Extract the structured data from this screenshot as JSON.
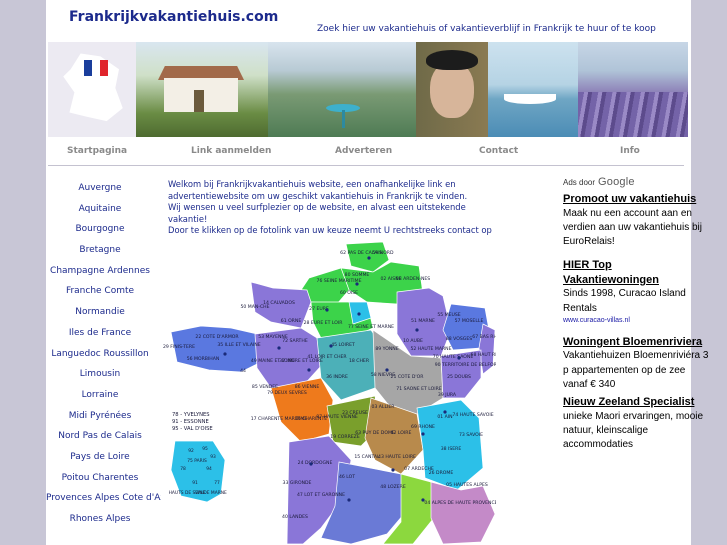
{
  "site": {
    "title": "Frankrijkvakantiehuis.com",
    "tagline": "Zoek hier uw vakantiehuis of vakantieverblijf in Frankrijk te huur of te koop"
  },
  "flag_colors": [
    "#1a3e9c",
    "#ffffff",
    "#e0242c"
  ],
  "nav": [
    {
      "label": "Startpagina"
    },
    {
      "label": "Link aanmelden"
    },
    {
      "label": "Adverteren"
    },
    {
      "label": "Contact"
    },
    {
      "label": "Info"
    }
  ],
  "regions": [
    "Auvergne",
    "Aquitaine",
    "Bourgogne",
    "Bretagne",
    "Champagne Ardennes",
    "Franche Comte",
    "Normandie",
    "Iles de France",
    "Languedoc Roussillon",
    "Limousin",
    "Lorraine",
    "Midi Pyrénées",
    "Nord Pas de Calais",
    "Pays de Loire",
    "Poitou Charentes",
    "Provences Alpes Cote d'Azur",
    "Rhones Alpes"
  ],
  "intro": {
    "line1": "Welkom bij Frankrijkvakantiehuis website, een onafhankelijke link en advertentiewebsite om uw geschikt vakantiehuis in Frankrijk te vinden.",
    "line2": "Wij wensen u veel surfplezier op de website, en alvast een uitstekende vakantie!",
    "line3": "Door te klikken op de fotolink van uw keuze neemt U rechtstreeks contact op met de verhuurder/aanbieder."
  },
  "map": {
    "labels": [
      {
        "t": "62 PAS DE CALAIS"
      },
      {
        "t": "59 NORD"
      },
      {
        "t": "80 SOMME"
      },
      {
        "t": "02 AISNE"
      },
      {
        "t": "08 ARDEN-NES"
      },
      {
        "t": "76 SEINE MARITIME"
      },
      {
        "t": "50 MAN-CHE"
      },
      {
        "t": "14 CALVADOS"
      },
      {
        "t": "27 EURE"
      },
      {
        "t": "60 OISE"
      },
      {
        "t": "51 MARNE"
      },
      {
        "t": "55 MEUSE"
      },
      {
        "t": "57 MOSELLE"
      },
      {
        "t": "67 BAS RHIN"
      },
      {
        "t": "68 HAUT RHIN"
      },
      {
        "t": "29 FINIS-TERE"
      },
      {
        "t": "22 COTE D'ARMOR"
      },
      {
        "t": "35 ILLE ET VILAINE"
      },
      {
        "t": "56 MORBIHAN"
      },
      {
        "t": "44"
      },
      {
        "t": "53 MAYENNE"
      },
      {
        "t": "72 SARTHE"
      },
      {
        "t": "61 ORNE"
      },
      {
        "t": "28 EURE ET LOIR"
      },
      {
        "t": "45 LOIRET"
      },
      {
        "t": "41 LOIR ET CHER"
      },
      {
        "t": "37 INDRE ET LOIRE"
      },
      {
        "t": "49 MAINE ET LOIRE"
      },
      {
        "t": "36 INDRE"
      },
      {
        "t": "18 CHER"
      },
      {
        "t": "89 YONNE"
      },
      {
        "t": "10 AUBE"
      },
      {
        "t": "52 HAUTE MARNE"
      },
      {
        "t": "21 COTE D'OR"
      },
      {
        "t": "70 HAUTE SAONE"
      },
      {
        "t": "25 DOUBS"
      },
      {
        "t": "90 TERRITOIRE DE BELFORT"
      },
      {
        "t": "58 NIEVRE"
      },
      {
        "t": "71 SAONE ET LOIRE"
      },
      {
        "t": "39 JURA"
      },
      {
        "t": "86 VIENNE"
      },
      {
        "t": "79 DEUX SEVRES"
      },
      {
        "t": "85 VENDEE"
      },
      {
        "t": "17 CHARENTE MARITIME"
      },
      {
        "t": "16 CHARENTE"
      },
      {
        "t": "87 HAUTE VIENNE"
      },
      {
        "t": "23 CREUSE"
      },
      {
        "t": "03 ALLIER"
      },
      {
        "t": "19 CORREZE"
      },
      {
        "t": "63 PUY DE DOME"
      },
      {
        "t": "42 LOIRE"
      },
      {
        "t": "69 RHONE"
      },
      {
        "t": "01 AIN"
      },
      {
        "t": "74 HAUTE SAVOIE"
      },
      {
        "t": "73 SAVOIE"
      },
      {
        "t": "38 ISERE"
      },
      {
        "t": "24 DORDOGNE"
      },
      {
        "t": "33 GIRONDE"
      },
      {
        "t": "40 LANDES"
      },
      {
        "t": "15 CANTAL"
      },
      {
        "t": "43 HAUTE LOIRE"
      },
      {
        "t": "07 ARDECHE"
      },
      {
        "t": "26 DROME"
      },
      {
        "t": "05 HAUTES ALPES"
      },
      {
        "t": "04 ALPES DE HAUTE PROVENCE"
      },
      {
        "t": "48 LOZERE"
      },
      {
        "t": "46 LOT"
      },
      {
        "t": "47 LOT ET GARONNE"
      },
      {
        "t": "77 SEINE ET MARNE"
      },
      {
        "t": "88 VOSGES"
      }
    ],
    "idf_inset": {
      "legend": [
        "78 - YVELYNES",
        "91 - ESSONNE",
        "95 - VAL D'OISE"
      ],
      "labels": [
        "92",
        "95",
        "75 PARIS",
        "93",
        "94",
        "78",
        "91",
        "77",
        "VALDE MARNE",
        "HAUTS DE SEINE"
      ]
    },
    "colors": {
      "green": "#3cd34a",
      "purple": "#8a76d8",
      "blue": "#5a78e0",
      "orange": "#ee7a1c",
      "cyan": "#2cc0e8",
      "lime": "#8cd83e",
      "teal": "#4cb0b8",
      "grey": "#a6a6a6",
      "olive": "#7a9f2c",
      "brown": "#b88a4c",
      "mauve": "#c48ac8",
      "navy": "#6a7ad6",
      "dot": "#1a2a7a"
    }
  },
  "ads": {
    "ads_by": "Ads door",
    "google": "Google",
    "items": [
      {
        "title": "Promoot uw vakantiehuis",
        "body": "Maak nu een account aan en verdien aan uw vakantiehuis bij EuroRelais!",
        "url": ""
      },
      {
        "title": "HIER Top Vakantiewoningen",
        "body": "Sinds 1998, Curacao Island Rentals",
        "url": "www.curacao-villas.nl"
      },
      {
        "title": "Woningent Bloemenriviera",
        "body": "Vakantiehuizen Bloemenriviéra 3 p appartementen op de zee vanaf € 340",
        "url": ""
      },
      {
        "title": "Nieuw Zeeland Specialist",
        "body": "unieke Maori ervaringen, mooie natuur, kleinscalige accommodaties",
        "url": ""
      }
    ]
  }
}
